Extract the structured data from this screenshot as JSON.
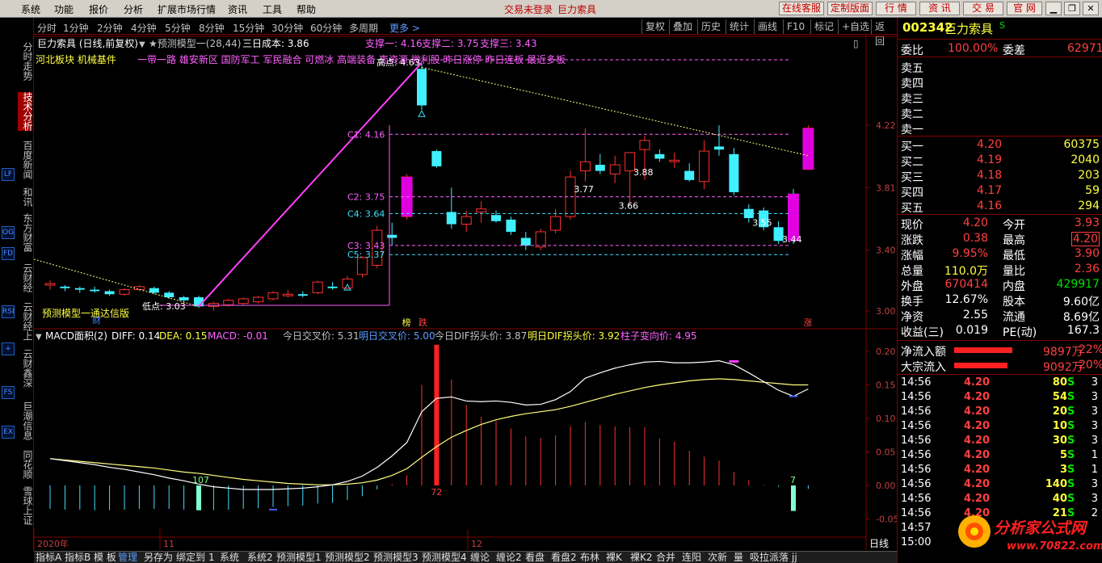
{
  "menu": {
    "items": [
      "系统",
      "功能",
      "报价",
      "分析",
      "扩展市场行情",
      "资讯",
      "工具",
      "帮助"
    ],
    "trade_status": "交易未登录",
    "stock_title": "巨力索具",
    "buttons": [
      "在线客服",
      "定制版面",
      "行 情",
      "资 讯",
      "交 易",
      "官 网"
    ]
  },
  "periods": {
    "items": [
      "分时",
      "1分钟",
      "2分钟",
      "4分钟",
      "5分钟",
      "8分钟",
      "15分钟",
      "30分钟",
      "60分钟",
      "多周期"
    ],
    "more": "更多 >",
    "tools": [
      "复权",
      "叠加",
      "历史",
      "统计",
      "画线",
      "F10",
      "标记",
      "+自选",
      "返回"
    ]
  },
  "left_tabs": [
    "分时走势",
    "技术分析",
    "百度新闻",
    "和讯",
    "东方财富",
    "云财经",
    "云财经上",
    "云财鑫深",
    "巨潮信息",
    "同花顺",
    "雪球上证"
  ],
  "left_icons": [
    "LF",
    "OG",
    "FD",
    "RSI",
    "+",
    "FS",
    "EX"
  ],
  "info": {
    "title": "巨力索具 (日线,前复权)",
    "indicator": "★预测模型一(28,44)",
    "cost": "三日成本: 3.86",
    "support1": "支撑一: 4.16",
    "support2": "支撑二: 3.75",
    "support3": "支撑三: 3.43",
    "concepts_yellow": "河北板块   机械基件",
    "concepts": "一带一路 雄安新区 国防军工 军民融合 可燃冰 高端装备 壳资源 微利股 昨日涨停 昨日连板 最近多板",
    "model_label": "预测模型一通达信版",
    "low_label": "低点: 3.03",
    "high_label": "高点: 4.63"
  },
  "macd": {
    "name": "MACD面积(2)",
    "diff": "DIFF: 0.14",
    "dea": "DEA: 0.15",
    "macd": "MACD: -0.01",
    "today_cross": "今日交叉价: 5.31",
    "tomorrow_cross": "明日交叉价: 5.00",
    "today_dif": "今日DIF拐头价: 3.87",
    "tomorrow_dif": "明日DIF拐头价: 3.92",
    "pillar": "柱子变向价: 4.95",
    "area_labels": [
      "107",
      "72",
      "7"
    ]
  },
  "chart_data": {
    "type": "candlestick",
    "price_axis": [
      "4.22",
      "3.81",
      "3.40",
      "3.00"
    ],
    "macd_axis": [
      "0.20",
      "0.15",
      "0.10",
      "0.05",
      "0.00",
      "-0.05"
    ],
    "date_labels": [
      "2020年",
      "11",
      "12"
    ],
    "levels": [
      {
        "label": "C1: 4.16",
        "value": 4.16,
        "color": "#ff60ff"
      },
      {
        "label": "C2: 3.75",
        "value": 3.75,
        "color": "#ff60ff"
      },
      {
        "label": "C4: 3.64",
        "value": 3.64,
        "color": "#40e0ff"
      },
      {
        "label": "C3: 3.43",
        "value": 3.43,
        "color": "#ff60ff"
      },
      {
        "label": "C5: 3.37",
        "value": 3.37,
        "color": "#40e0ff"
      }
    ],
    "annotations": [
      "3.77",
      "3.88",
      "3.66",
      "3.55",
      "3.44"
    ],
    "markers": [
      "榜",
      "跌",
      "涨",
      "财"
    ],
    "candles": [
      [
        3.17,
        3.2,
        3.14,
        3.18
      ],
      [
        3.16,
        3.17,
        3.13,
        3.15
      ],
      [
        3.15,
        3.16,
        3.12,
        3.14
      ],
      [
        3.14,
        3.16,
        3.12,
        3.13
      ],
      [
        3.13,
        3.14,
        3.1,
        3.11
      ],
      [
        3.11,
        3.15,
        3.1,
        3.14
      ],
      [
        3.14,
        3.17,
        3.13,
        3.16
      ],
      [
        3.15,
        3.16,
        3.11,
        3.12
      ],
      [
        3.12,
        3.13,
        3.08,
        3.09
      ],
      [
        3.09,
        3.1,
        3.06,
        3.07
      ],
      [
        3.09,
        3.1,
        3.02,
        3.03
      ],
      [
        3.03,
        3.06,
        3.0,
        3.05
      ],
      [
        3.04,
        3.08,
        3.03,
        3.07
      ],
      [
        3.05,
        3.09,
        3.04,
        3.08
      ],
      [
        3.06,
        3.1,
        3.05,
        3.09
      ],
      [
        3.08,
        3.13,
        3.07,
        3.12
      ],
      [
        3.1,
        3.14,
        3.09,
        3.11
      ],
      [
        3.11,
        3.13,
        3.09,
        3.1
      ],
      [
        3.12,
        3.2,
        3.11,
        3.19
      ],
      [
        3.16,
        3.19,
        3.14,
        3.15
      ],
      [
        3.15,
        3.23,
        3.14,
        3.21
      ],
      [
        3.24,
        3.36,
        3.22,
        3.35
      ],
      [
        3.3,
        3.56,
        3.28,
        3.53
      ],
      [
        3.5,
        3.58,
        3.43,
        3.48
      ],
      [
        3.62,
        3.9,
        3.6,
        3.88
      ],
      [
        4.59,
        4.63,
        4.32,
        4.35
      ],
      [
        4.05,
        4.06,
        3.94,
        3.95
      ],
      [
        3.65,
        3.81,
        3.54,
        3.57
      ],
      [
        3.57,
        3.66,
        3.52,
        3.62
      ],
      [
        3.65,
        3.72,
        3.58,
        3.67
      ],
      [
        3.63,
        3.66,
        3.58,
        3.59
      ],
      [
        3.6,
        3.62,
        3.5,
        3.52
      ],
      [
        3.48,
        3.52,
        3.4,
        3.43
      ],
      [
        3.42,
        3.54,
        3.4,
        3.52
      ],
      [
        3.53,
        3.67,
        3.51,
        3.62
      ],
      [
        3.62,
        3.92,
        3.6,
        3.88
      ],
      [
        3.92,
        4.2,
        3.85,
        3.98
      ],
      [
        3.96,
        4.03,
        3.9,
        3.92
      ],
      [
        3.9,
        4.02,
        3.84,
        3.96
      ],
      [
        3.92,
        4.02,
        3.69,
        4.04
      ],
      [
        4.06,
        4.15,
        3.86,
        4.12
      ],
      [
        4.03,
        4.06,
        3.98,
        4.0
      ],
      [
        3.98,
        4.04,
        3.94,
        3.99
      ],
      [
        3.92,
        3.97,
        3.85,
        3.86
      ],
      [
        3.85,
        4.12,
        3.8,
        4.05
      ],
      [
        4.08,
        4.22,
        4.02,
        4.06
      ],
      [
        4.03,
        4.07,
        3.76,
        3.78
      ],
      [
        3.67,
        3.7,
        3.58,
        3.61
      ],
      [
        3.66,
        3.68,
        3.53,
        3.55
      ],
      [
        3.55,
        3.59,
        3.44,
        3.46
      ],
      [
        3.77,
        3.8,
        3.44,
        3.46
      ],
      [
        3.93,
        4.22,
        3.93,
        4.2
      ]
    ],
    "macd_bars": [
      -0.035,
      -0.036,
      -0.036,
      -0.037,
      -0.037,
      -0.036,
      -0.035,
      -0.035,
      -0.035,
      -0.036,
      -0.037,
      -0.037,
      -0.036,
      -0.035,
      -0.034,
      -0.032,
      -0.031,
      -0.03,
      -0.027,
      -0.026,
      -0.022,
      -0.016,
      -0.006,
      0.002,
      0.015,
      0.15,
      0.21,
      0.158,
      0.12,
      0.102,
      0.096,
      0.085,
      0.073,
      0.071,
      0.075,
      0.088,
      0.095,
      0.09,
      0.088,
      0.087,
      0.087,
      0.07,
      0.065,
      0.052,
      0.043,
      0.037,
      0.02,
      0.008,
      0.001,
      -0.002,
      -0.038,
      -0.005
    ],
    "dif": [
      0.04,
      0.037,
      0.034,
      0.031,
      0.027,
      0.024,
      0.02,
      0.016,
      0.011,
      0.007,
      0.002,
      -0.002,
      -0.004,
      -0.006,
      -0.006,
      -0.006,
      -0.005,
      -0.004,
      -0.002,
      0.001,
      0.006,
      0.014,
      0.027,
      0.044,
      0.064,
      0.11,
      0.13,
      0.132,
      0.126,
      0.125,
      0.126,
      0.124,
      0.12,
      0.121,
      0.128,
      0.14,
      0.16,
      0.168,
      0.175,
      0.18,
      0.184,
      0.185,
      0.183,
      0.183,
      0.184,
      0.186,
      0.18,
      0.168,
      0.155,
      0.142,
      0.133,
      0.144
    ],
    "dea": [
      0.04,
      0.038,
      0.036,
      0.034,
      0.032,
      0.03,
      0.028,
      0.026,
      0.023,
      0.02,
      0.018,
      0.015,
      0.012,
      0.009,
      0.007,
      0.005,
      0.003,
      0.002,
      0.001,
      0.001,
      0.002,
      0.004,
      0.008,
      0.015,
      0.025,
      0.042,
      0.058,
      0.072,
      0.082,
      0.091,
      0.098,
      0.103,
      0.107,
      0.11,
      0.113,
      0.118,
      0.124,
      0.13,
      0.136,
      0.141,
      0.146,
      0.15,
      0.153,
      0.156,
      0.158,
      0.159,
      0.158,
      0.156,
      0.154,
      0.152,
      0.15,
      0.15
    ]
  },
  "quote": {
    "code": "002342",
    "name": "巨力索具",
    "flag": "S",
    "weibi_label": "委比",
    "weibi": "100.00%",
    "weicha_label": "委差",
    "weicha": "62971",
    "asks": [
      "卖五",
      "卖四",
      "卖三",
      "卖二",
      "卖一"
    ],
    "bids": [
      {
        "label": "买一",
        "price": "4.20",
        "vol": "60375"
      },
      {
        "label": "买二",
        "price": "4.19",
        "vol": "2040"
      },
      {
        "label": "买三",
        "price": "4.18",
        "vol": "203"
      },
      {
        "label": "买四",
        "price": "4.17",
        "vol": "59"
      },
      {
        "label": "买五",
        "price": "4.16",
        "vol": "294"
      }
    ],
    "stats": [
      {
        "l1": "现价",
        "v1": "4.20",
        "c1": "red",
        "l2": "今开",
        "v2": "3.93",
        "c2": "red"
      },
      {
        "l1": "涨跌",
        "v1": "0.38",
        "c1": "red",
        "l2": "最高",
        "v2": "4.20",
        "c2": "red"
      },
      {
        "l1": "涨幅",
        "v1": "9.95%",
        "c1": "red",
        "l2": "最低",
        "v2": "3.90",
        "c2": "red"
      },
      {
        "l1": "总量",
        "v1": "110.0万",
        "c1": "yellow",
        "l2": "量比",
        "v2": "2.36",
        "c2": "red"
      },
      {
        "l1": "外盘",
        "v1": "670414",
        "c1": "red",
        "l2": "内盘",
        "v2": "429917",
        "c2": "green"
      },
      {
        "l1": "换手",
        "v1": "12.67%",
        "c1": "white",
        "l2": "股本",
        "v2": "9.60亿",
        "c2": "white"
      },
      {
        "l1": "净资",
        "v1": "2.55",
        "c1": "white",
        "l2": "流通",
        "v2": "8.69亿",
        "c2": "white"
      },
      {
        "l1": "收益(三)",
        "v1": "0.019",
        "c1": "white",
        "l2": "PE(动)",
        "v2": "167.3",
        "c2": "white"
      }
    ],
    "net_inflow_label": "净流入额",
    "net_inflow": "9897万",
    "net_inflow_pct": "22%",
    "block_inflow_label": "大宗流入",
    "block_inflow": "9092万",
    "block_inflow_pct": "20%",
    "ticks": [
      {
        "t": "14:56",
        "p": "4.20",
        "v": "80",
        "s": "S",
        "n": "3"
      },
      {
        "t": "14:56",
        "p": "4.20",
        "v": "54",
        "s": "S",
        "n": "3"
      },
      {
        "t": "14:56",
        "p": "4.20",
        "v": "20",
        "s": "S",
        "n": "3"
      },
      {
        "t": "14:56",
        "p": "4.20",
        "v": "10",
        "s": "S",
        "n": "3"
      },
      {
        "t": "14:56",
        "p": "4.20",
        "v": "30",
        "s": "S",
        "n": "3"
      },
      {
        "t": "14:56",
        "p": "4.20",
        "v": "5",
        "s": "S",
        "n": "1"
      },
      {
        "t": "14:56",
        "p": "4.20",
        "v": "3",
        "s": "S",
        "n": "1"
      },
      {
        "t": "14:56",
        "p": "4.20",
        "v": "140",
        "s": "S",
        "n": "3"
      },
      {
        "t": "14:56",
        "p": "4.20",
        "v": "40",
        "s": "S",
        "n": "3"
      },
      {
        "t": "14:56",
        "p": "4.20",
        "v": "21",
        "s": "S",
        "n": "2"
      },
      {
        "t": "14:57",
        "p": "",
        "v": "",
        "s": "",
        "n": ""
      },
      {
        "t": "15:00",
        "p": "",
        "v": "",
        "s": "",
        "n": ""
      }
    ]
  },
  "bottom": {
    "tabs": [
      "指标A",
      "指标B",
      "模 板",
      "管理",
      "另存为",
      "绑定到",
      "1",
      "系统",
      "系统2",
      "预测模型1",
      "预测模型2",
      "预测模型3",
      "预测模型4",
      "缠论",
      "缠论2",
      "看盘",
      "看盘2",
      "布林",
      "裸K",
      "裸K2",
      "合并",
      "连阳",
      "次新",
      "量",
      "吸拉派落",
      "jj"
    ],
    "period_label": "日线"
  },
  "watermark": {
    "title": "分析家公式网",
    "url": "www.70822.com"
  }
}
